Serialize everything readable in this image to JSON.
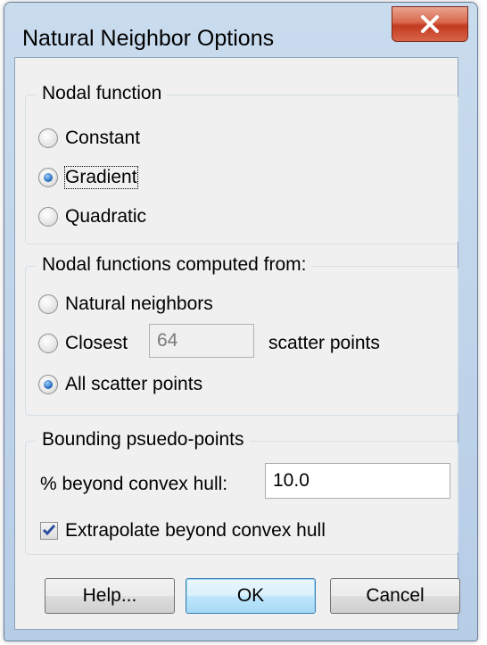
{
  "window": {
    "title": "Natural Neighbor Options"
  },
  "nodal_function": {
    "title": "Nodal function",
    "options": [
      {
        "label": "Constant",
        "selected": false
      },
      {
        "label": "Gradient",
        "selected": true
      },
      {
        "label": "Quadratic",
        "selected": false
      }
    ]
  },
  "computed_from": {
    "title": "Nodal functions computed from:",
    "natural_neighbors": {
      "label": "Natural neighbors",
      "selected": false
    },
    "closest": {
      "label": "Closest",
      "value": "64",
      "suffix": "scatter points",
      "selected": false
    },
    "all_scatter": {
      "label": "All scatter points",
      "selected": true
    }
  },
  "bounding": {
    "title": "Bounding psuedo-points",
    "hull_label": "% beyond convex hull:",
    "hull_value": "10.0",
    "extrapolate_label": "Extrapolate beyond convex hull",
    "extrapolate_checked": true
  },
  "buttons": {
    "help": "Help...",
    "ok": "OK",
    "cancel": "Cancel"
  },
  "icons": {
    "close": "close-icon",
    "check": "check-icon"
  }
}
